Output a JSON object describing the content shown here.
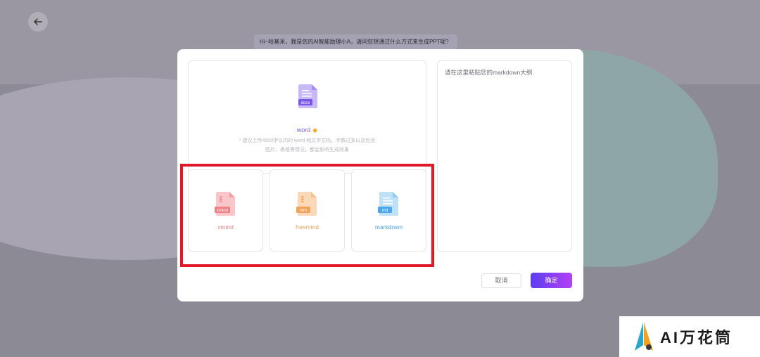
{
  "page": {
    "greeting": "Hi~哈基米，我是您的AI智能助理小A，请问您想通过什么方式来生成PPT呢？"
  },
  "modal": {
    "word": {
      "label": "word",
      "badge": "docx",
      "hint_line1": "* 建议上传4500字以内的 word 纯文字文档，字数过多以及包含",
      "hint_line2": "图片、表格等情况，都会影响生成效果"
    },
    "options": [
      {
        "label": "xmind",
        "badge": "xmind",
        "color": "#f07f86"
      },
      {
        "label": "freemind",
        "badge": "mm",
        "color": "#f3a25a"
      },
      {
        "label": "markdown",
        "badge": "md",
        "color": "#4aa8ea"
      }
    ],
    "textarea": {
      "placeholder": "请在这里粘贴您的markdown大纲"
    },
    "cancel_label": "取消",
    "ok_label": "确定"
  },
  "watermark": {
    "text": "AI万花筒"
  },
  "colors": {
    "accent": "#6a4cf0",
    "highlight": "#e0182a"
  }
}
